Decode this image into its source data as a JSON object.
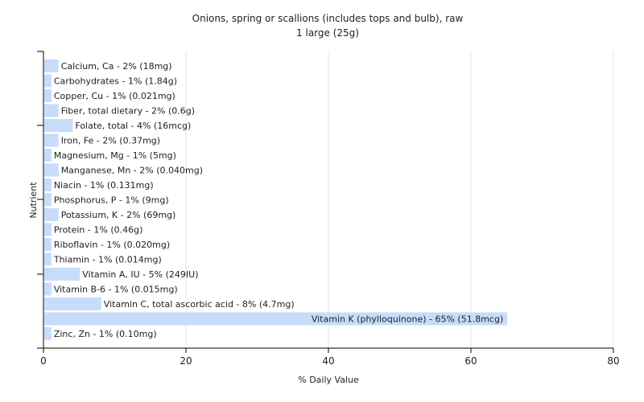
{
  "chart_data": {
    "type": "bar",
    "orientation": "horizontal",
    "title": "Onions, spring or scallions (includes tops and bulb), raw",
    "subtitle": "1 large (25g)",
    "xlabel": "% Daily Value",
    "ylabel": "Nutrient",
    "xlim": [
      0,
      80
    ],
    "xticks": [
      0,
      20,
      40,
      60,
      80
    ],
    "grid": true,
    "bar_color": "#c6dcfa",
    "categories": [
      "Calcium, Ca",
      "Carbohydrates",
      "Copper, Cu",
      "Fiber, total dietary",
      "Folate, total",
      "Iron, Fe",
      "Magnesium, Mg",
      "Manganese, Mn",
      "Niacin",
      "Phosphorus, P",
      "Potassium, K",
      "Protein",
      "Riboflavin",
      "Thiamin",
      "Vitamin A, IU",
      "Vitamin B-6",
      "Vitamin C, total ascorbic acid",
      "Vitamin K (phylloquinone)",
      "Zinc, Zn"
    ],
    "values": [
      2,
      1,
      1,
      2,
      4,
      2,
      1,
      2,
      1,
      1,
      2,
      1,
      1,
      1,
      5,
      1,
      8,
      65,
      1
    ],
    "labels": [
      "Calcium, Ca - 2% (18mg)",
      "Carbohydrates - 1% (1.84g)",
      "Copper, Cu - 1% (0.021mg)",
      "Fiber, total dietary - 2% (0.6g)",
      "Folate, total - 4% (16mcg)",
      "Iron, Fe - 2% (0.37mg)",
      "Magnesium, Mg - 1% (5mg)",
      "Manganese, Mn - 2% (0.040mg)",
      "Niacin - 1% (0.131mg)",
      "Phosphorus, P - 1% (9mg)",
      "Potassium, K - 2% (69mg)",
      "Protein - 1% (0.46g)",
      "Riboflavin - 1% (0.020mg)",
      "Thiamin - 1% (0.014mg)",
      "Vitamin A, IU - 5% (249IU)",
      "Vitamin B-6 - 1% (0.015mg)",
      "Vitamin C, total ascorbic acid - 8% (4.7mg)",
      "Vitamin K (phylloquinone) - 65% (51.8mcg)",
      "Zinc, Zn - 1% (0.10mg)"
    ]
  }
}
